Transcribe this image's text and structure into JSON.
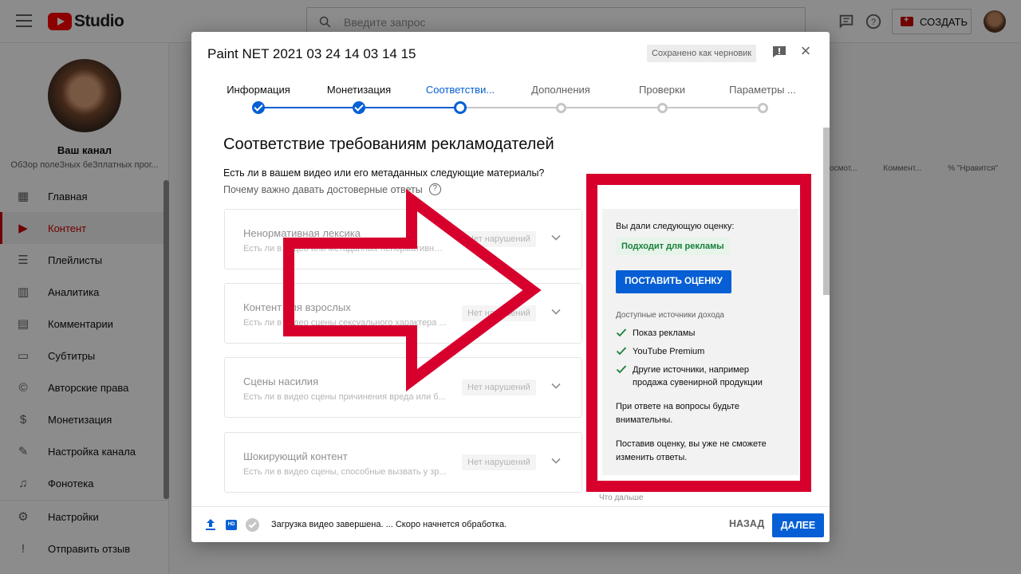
{
  "app": {
    "logo_text": "Studio",
    "search_placeholder": "Введите запрос",
    "create_label": "СОЗДАТЬ"
  },
  "sidebar": {
    "channel_title": "Ваш канал",
    "channel_name": "ОбЗор полеЗных беЗплатных прог...",
    "items": [
      {
        "label": "Главная",
        "icon": "dashboard-icon"
      },
      {
        "label": "Контент",
        "icon": "content-icon",
        "active": true
      },
      {
        "label": "Плейлисты",
        "icon": "playlists-icon"
      },
      {
        "label": "Аналитика",
        "icon": "analytics-icon"
      },
      {
        "label": "Комментарии",
        "icon": "comments-icon"
      },
      {
        "label": "Субтитры",
        "icon": "subtitles-icon"
      },
      {
        "label": "Авторские права",
        "icon": "copyright-icon"
      },
      {
        "label": "Монетизация",
        "icon": "monetization-icon"
      },
      {
        "label": "Настройка канала",
        "icon": "customization-icon"
      },
      {
        "label": "Фонотека",
        "icon": "audio-library-icon"
      }
    ],
    "bottom_items": [
      {
        "label": "Настройки",
        "icon": "settings-icon"
      },
      {
        "label": "Отправить отзыв",
        "icon": "feedback-icon"
      }
    ]
  },
  "background_table": {
    "headers": [
      "осмот...",
      "Коммент...",
      "% \"Нравится\""
    ]
  },
  "modal": {
    "title": "Paint NET 2021 03 24 14 03 14 15",
    "draft_status": "Сохранено как черновик",
    "steps": [
      {
        "label": "Информация",
        "state": "done"
      },
      {
        "label": "Монетизация",
        "state": "done"
      },
      {
        "label": "Соответстви...",
        "state": "current"
      },
      {
        "label": "Дополнения",
        "state": "todo"
      },
      {
        "label": "Проверки",
        "state": "todo"
      },
      {
        "label": "Параметры ...",
        "state": "todo"
      }
    ],
    "section_title": "Соответствие требованиям рекламодателей",
    "question": "Есть ли в вашем видео или его метаданных следующие материалы?",
    "why_link": "Почему важно давать достоверные ответы",
    "cards": [
      {
        "title": "Ненормативная лексика",
        "desc": "Есть ли в видео или метаданных ненормативная выра...",
        "chip": "Нет нарушений"
      },
      {
        "title": "Контент для взрослых",
        "desc": "Есть ли в видео сцены сексуального характера ...",
        "chip": "Нет нарушений"
      },
      {
        "title": "Сцены насилия",
        "desc": "Есть ли в видео сцены причинения вреда или б...",
        "chip": "Нет нарушений"
      },
      {
        "title": "Шокирующий контент",
        "desc": "Есть ли в видео сцены, способные вызвать у зр...",
        "chip": "Нет нарушений"
      }
    ],
    "panel": {
      "label": "Вы дали следующую оценку:",
      "badge": "Подходит для рекламы",
      "button": "ПОСТАВИТЬ ОЦЕНКУ",
      "sources_label": "Доступные источники дохода",
      "sources": [
        "Показ рекламы",
        "YouTube Premium",
        "Другие источники, например продажа сувенирной продукции"
      ],
      "note1": "При ответе на вопросы будьте внимательны.",
      "note2": "Поставив оценку, вы уже не сможете изменить ответы."
    },
    "next_hint": "Что дальше",
    "footer": {
      "hd_badge": "HD",
      "status": "Загрузка видео завершена. ... Скоро начнется обработка.",
      "back": "НАЗАД",
      "next": "ДАЛЕЕ"
    }
  },
  "colors": {
    "accent": "#065fd4",
    "brand_red": "#ff0000",
    "annotation_red": "#d7002d",
    "success_green": "#188038"
  }
}
